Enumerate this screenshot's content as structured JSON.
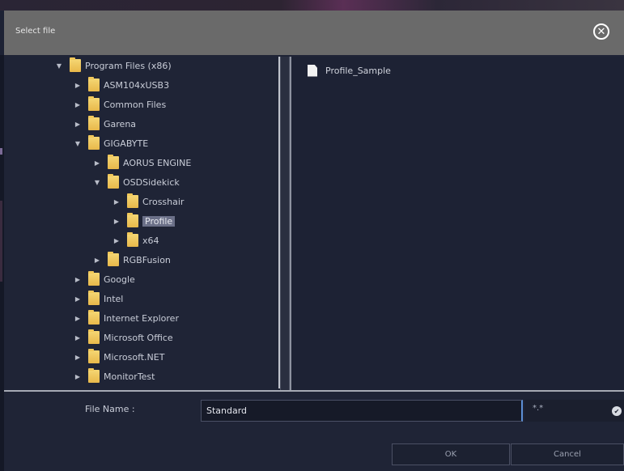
{
  "window": {
    "title": "Select file"
  },
  "tree": [
    {
      "label": "Program Files (x86)",
      "arrow": "▼",
      "selected": false
    },
    {
      "label": "ASM104xUSB3",
      "arrow": "▶",
      "selected": false
    },
    {
      "label": "Common Files",
      "arrow": "▶",
      "selected": false
    },
    {
      "label": "Garena",
      "arrow": "▶",
      "selected": false
    },
    {
      "label": "GIGABYTE",
      "arrow": "▼",
      "selected": false
    },
    {
      "label": "AORUS ENGINE",
      "arrow": "▶",
      "selected": false
    },
    {
      "label": "OSDSidekick",
      "arrow": "▼",
      "selected": false
    },
    {
      "label": "Crosshair",
      "arrow": "▶",
      "selected": false
    },
    {
      "label": "Profile",
      "arrow": "▶",
      "selected": true
    },
    {
      "label": "x64",
      "arrow": "▶",
      "selected": false
    },
    {
      "label": "RGBFusion",
      "arrow": "▶",
      "selected": false
    },
    {
      "label": "Google",
      "arrow": "▶",
      "selected": false
    },
    {
      "label": "Intel",
      "arrow": "▶",
      "selected": false
    },
    {
      "label": "Internet Explorer",
      "arrow": "▶",
      "selected": false
    },
    {
      "label": "Microsoft Office",
      "arrow": "▶",
      "selected": false
    },
    {
      "label": "Microsoft.NET",
      "arrow": "▶",
      "selected": false
    },
    {
      "label": "MonitorTest",
      "arrow": "▶",
      "selected": false
    }
  ],
  "files": [
    {
      "name": "Profile_Sample"
    }
  ],
  "footer": {
    "file_name_label": "File Name :",
    "file_name_value": "Standard",
    "filter_value": "*.*",
    "ok_label": "OK",
    "cancel_label": "Cancel"
  },
  "colors": {
    "selection": "#6b7088",
    "focus_border": "#5c8fd6",
    "folder": "#e8b84a"
  }
}
